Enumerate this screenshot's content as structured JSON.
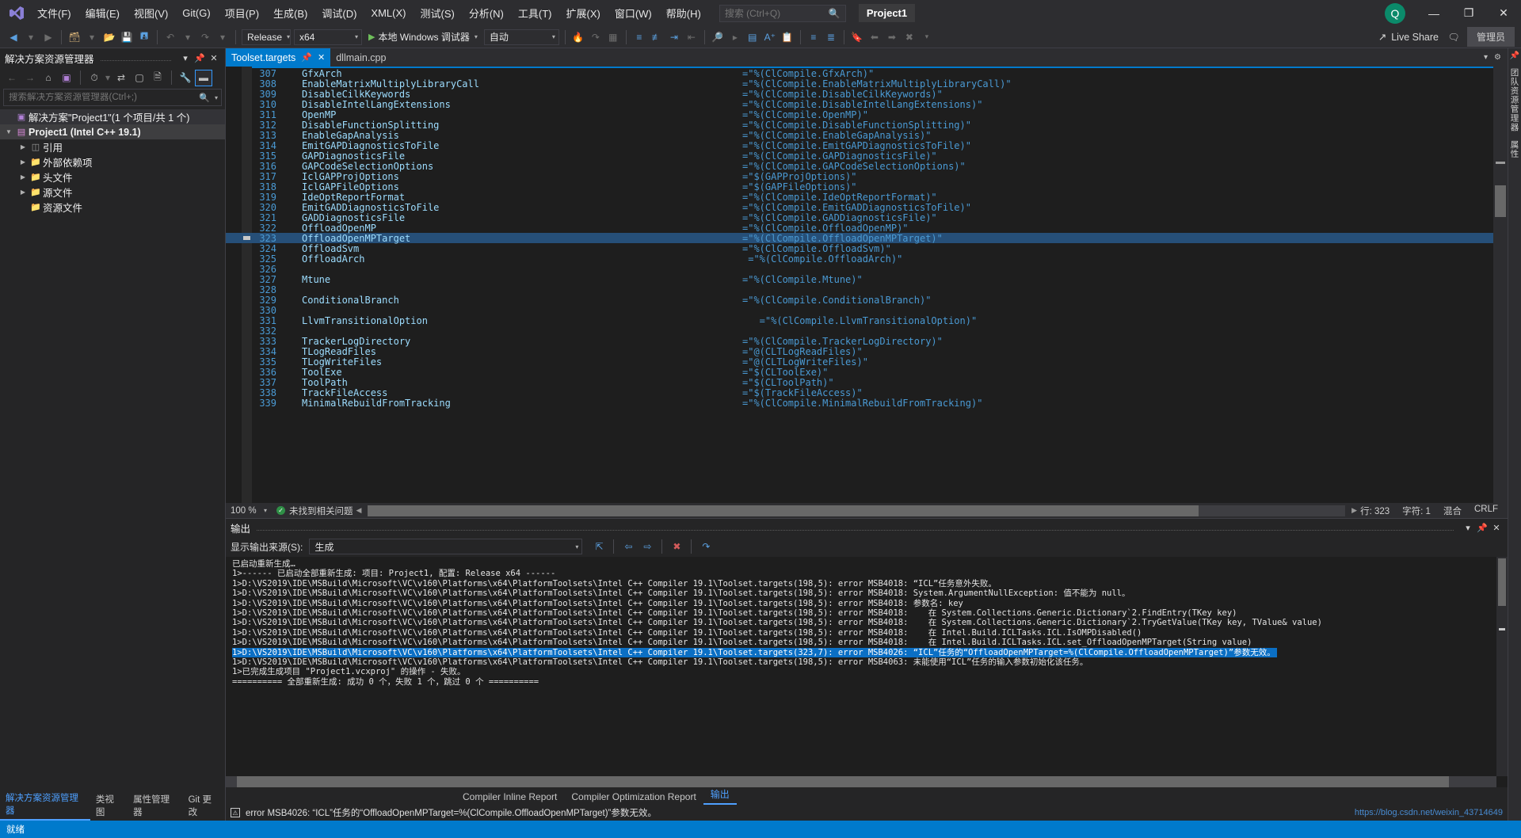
{
  "titlebar": {
    "logo_icon": "visual-studio-logo",
    "menus": [
      "文件(F)",
      "编辑(E)",
      "视图(V)",
      "Git(G)",
      "项目(P)",
      "生成(B)",
      "调试(D)",
      "XML(X)",
      "测试(S)",
      "分析(N)",
      "工具(T)",
      "扩展(X)",
      "窗口(W)",
      "帮助(H)"
    ],
    "search_placeholder": "搜索 (Ctrl+Q)",
    "search_value": "",
    "project_chip": "Project1",
    "account_initial": "Q",
    "minimize": "—",
    "maximize": "❐",
    "close": "✕"
  },
  "toolbar": {
    "config": "Release",
    "platform": "x64",
    "debugger": "本地 Windows 调试器",
    "auto": "自动",
    "live_share": "Live Share",
    "admin_label": "管理员"
  },
  "solution_explorer": {
    "title": "解决方案资源管理器",
    "search_placeholder": "搜索解决方案资源管理器(Ctrl+;)",
    "solution_node": "解决方案\"Project1\"(1 个项目/共 1 个)",
    "project_node": "Project1 (Intel C++ 19.1)",
    "children": [
      "引用",
      "外部依赖项",
      "头文件",
      "源文件",
      "资源文件"
    ],
    "footer_tabs": [
      "解决方案资源管理器",
      "类视图",
      "属性管理器",
      "Git 更改"
    ],
    "footer_active": "解决方案资源管理器"
  },
  "editor": {
    "tabs": [
      {
        "label": "Toolset.targets",
        "active": true,
        "pinnable": true,
        "closable": true
      },
      {
        "label": "dllmain.cpp",
        "active": false,
        "pinnable": false,
        "closable": false
      }
    ],
    "highlighted_line": 323,
    "lines": [
      {
        "n": 307,
        "name": "GfxArch",
        "val": "=\"%(ClCompile.GfxArch)\"",
        "indent": 0,
        "clipped": true
      },
      {
        "n": 308,
        "name": "EnableMatrixMultiplyLibraryCall",
        "val": "=\"%(ClCompile.EnableMatrixMultiplyLibraryCall)\""
      },
      {
        "n": 309,
        "name": "DisableCilkKeywords",
        "val": "=\"%(ClCompile.DisableCilkKeywords)\""
      },
      {
        "n": 310,
        "name": "DisableIntelLangExtensions",
        "val": "=\"%(ClCompile.DisableIntelLangExtensions)\""
      },
      {
        "n": 311,
        "name": "OpenMP",
        "val": "=\"%(ClCompile.OpenMP)\""
      },
      {
        "n": 312,
        "name": "DisableFunctionSplitting",
        "val": "=\"%(ClCompile.DisableFunctionSplitting)\""
      },
      {
        "n": 313,
        "name": "EnableGapAnalysis",
        "val": "=\"%(ClCompile.EnableGapAnalysis)\""
      },
      {
        "n": 314,
        "name": "EmitGAPDiagnosticsToFile",
        "val": "=\"%(ClCompile.EmitGAPDiagnosticsToFile)\""
      },
      {
        "n": 315,
        "name": "GAPDiagnosticsFile",
        "val": "=\"%(ClCompile.GAPDiagnosticsFile)\""
      },
      {
        "n": 316,
        "name": "GAPCodeSelectionOptions",
        "val": "=\"%(ClCompile.GAPCodeSelectionOptions)\""
      },
      {
        "n": 317,
        "name": "IclGAPProjOptions",
        "val": "=\"$(GAPProjOptions)\""
      },
      {
        "n": 318,
        "name": "IclGAPFileOptions",
        "val": "=\"$(GAPFileOptions)\""
      },
      {
        "n": 319,
        "name": "IdeOptReportFormat",
        "val": "=\"%(ClCompile.IdeOptReportFormat)\""
      },
      {
        "n": 320,
        "name": "EmitGADDiagnosticsToFile",
        "val": "=\"%(ClCompile.EmitGADDiagnosticsToFile)\""
      },
      {
        "n": 321,
        "name": "GADDiagnosticsFile",
        "val": "=\"%(ClCompile.GADDiagnosticsFile)\""
      },
      {
        "n": 322,
        "name": "OffloadOpenMP",
        "val": "=\"%(ClCompile.OffloadOpenMP)\""
      },
      {
        "n": 323,
        "name": "OffloadOpenMPTarget",
        "val": "=\"%(ClCompile.OffloadOpenMPTarget)\"",
        "hl": true
      },
      {
        "n": 324,
        "name": "OffloadSvm",
        "val": "=\"%(ClCompile.OffloadSvm)\""
      },
      {
        "n": 325,
        "name": "OffloadArch",
        "val": " =\"%(ClCompile.OffloadArch)\""
      },
      {
        "n": 326,
        "name": "",
        "val": ""
      },
      {
        "n": 327,
        "name": "Mtune",
        "val": "=\"%(ClCompile.Mtune)\""
      },
      {
        "n": 328,
        "name": "",
        "val": ""
      },
      {
        "n": 329,
        "name": "ConditionalBranch",
        "val": "=\"%(ClCompile.ConditionalBranch)\""
      },
      {
        "n": 330,
        "name": "",
        "val": ""
      },
      {
        "n": 331,
        "name": "LlvmTransitionalOption",
        "val": "   =\"%(ClCompile.LlvmTransitionalOption)\""
      },
      {
        "n": 332,
        "name": "",
        "val": ""
      },
      {
        "n": 333,
        "name": "TrackerLogDirectory",
        "val": "=\"%(ClCompile.TrackerLogDirectory)\""
      },
      {
        "n": 334,
        "name": "TLogReadFiles",
        "val": "=\"@(CLTLogReadFiles)\""
      },
      {
        "n": 335,
        "name": "TLogWriteFiles",
        "val": "=\"@(CLTLogWriteFiles)\""
      },
      {
        "n": 336,
        "name": "ToolExe",
        "val": "=\"$(CLToolExe)\""
      },
      {
        "n": 337,
        "name": "ToolPath",
        "val": "=\"$(CLToolPath)\""
      },
      {
        "n": 338,
        "name": "TrackFileAccess",
        "val": "=\"$(TrackFileAccess)\""
      },
      {
        "n": 339,
        "name": "MinimalRebuildFromTracking",
        "val": "=\"%(ClCompile.MinimalRebuildFromTracking)\"",
        "clipped": true
      }
    ],
    "status": {
      "zoom": "100 %",
      "issues": "未找到相关问题",
      "line_label": "行: 323",
      "col_label": "字符: 1",
      "encoding": "混合",
      "eol": "CRLF"
    }
  },
  "output": {
    "title": "输出",
    "source_label": "显示输出来源(S):",
    "source_value": "生成",
    "lines": [
      {
        "t": "已启动重新生成…"
      },
      {
        "t": "1>------ 已启动全部重新生成: 项目: Project1, 配置: Release x64 ------"
      },
      {
        "t": "1>D:\\VS2019\\IDE\\MSBuild\\Microsoft\\VC\\v160\\Platforms\\x64\\PlatformToolsets\\Intel C++ Compiler 19.1\\Toolset.targets(198,5): error MSB4018: “ICL”任务意外失败。"
      },
      {
        "t": "1>D:\\VS2019\\IDE\\MSBuild\\Microsoft\\VC\\v160\\Platforms\\x64\\PlatformToolsets\\Intel C++ Compiler 19.1\\Toolset.targets(198,5): error MSB4018: System.ArgumentNullException: 值不能为 null。"
      },
      {
        "t": "1>D:\\VS2019\\IDE\\MSBuild\\Microsoft\\VC\\v160\\Platforms\\x64\\PlatformToolsets\\Intel C++ Compiler 19.1\\Toolset.targets(198,5): error MSB4018: 参数名: key"
      },
      {
        "t": "1>D:\\VS2019\\IDE\\MSBuild\\Microsoft\\VC\\v160\\Platforms\\x64\\PlatformToolsets\\Intel C++ Compiler 19.1\\Toolset.targets(198,5): error MSB4018:    在 System.Collections.Generic.Dictionary`2.FindEntry(TKey key)"
      },
      {
        "t": "1>D:\\VS2019\\IDE\\MSBuild\\Microsoft\\VC\\v160\\Platforms\\x64\\PlatformToolsets\\Intel C++ Compiler 19.1\\Toolset.targets(198,5): error MSB4018:    在 System.Collections.Generic.Dictionary`2.TryGetValue(TKey key, TValue& value)"
      },
      {
        "t": "1>D:\\VS2019\\IDE\\MSBuild\\Microsoft\\VC\\v160\\Platforms\\x64\\PlatformToolsets\\Intel C++ Compiler 19.1\\Toolset.targets(198,5): error MSB4018:    在 Intel.Build.ICLTasks.ICL.IsOMPDisabled()"
      },
      {
        "t": "1>D:\\VS2019\\IDE\\MSBuild\\Microsoft\\VC\\v160\\Platforms\\x64\\PlatformToolsets\\Intel C++ Compiler 19.1\\Toolset.targets(198,5): error MSB4018:    在 Intel.Build.ICLTasks.ICL.set_OffloadOpenMPTarget(String value)"
      },
      {
        "t": "1>D:\\VS2019\\IDE\\MSBuild\\Microsoft\\VC\\v160\\Platforms\\x64\\PlatformToolsets\\Intel C++ Compiler 19.1\\Toolset.targets(323,7): error MSB4026: “ICL”任务的“OffloadOpenMPTarget=%(ClCompile.OffloadOpenMPTarget)”参数无效。",
        "hl": true
      },
      {
        "t": "1>D:\\VS2019\\IDE\\MSBuild\\Microsoft\\VC\\v160\\Platforms\\x64\\PlatformToolsets\\Intel C++ Compiler 19.1\\Toolset.targets(198,5): error MSB4063: 未能使用“ICL”任务的输入参数初始化该任务。"
      },
      {
        "t": "1>已完成生成项目 \"Project1.vcxproj\" 的操作 - 失败。"
      },
      {
        "t": "========== 全部重新生成: 成功 0 个，失败 1 个，跳过 0 个 =========="
      }
    ]
  },
  "bottom_tabs": {
    "items": [
      "Compiler Inline Report",
      "Compiler Optimization Report",
      "输出"
    ],
    "active": "输出"
  },
  "error_bar": {
    "text": "error MSB4026: “ICL”任务的“OffloadOpenMPTarget=%(ClCompile.OffloadOpenMPTarget)”参数无效。",
    "watermark": "https://blog.csdn.net/weixin_43714649"
  },
  "status_bar": {
    "text": "就绪"
  },
  "right_rail": {
    "labels": [
      "团队资源管理器",
      "属性"
    ]
  },
  "colors": {
    "accent": "#007acc",
    "selection": "#264f78",
    "output_highlight": "#0b6fc4",
    "chrome": "#2d2d30",
    "editor_bg": "#1e1e1e"
  }
}
